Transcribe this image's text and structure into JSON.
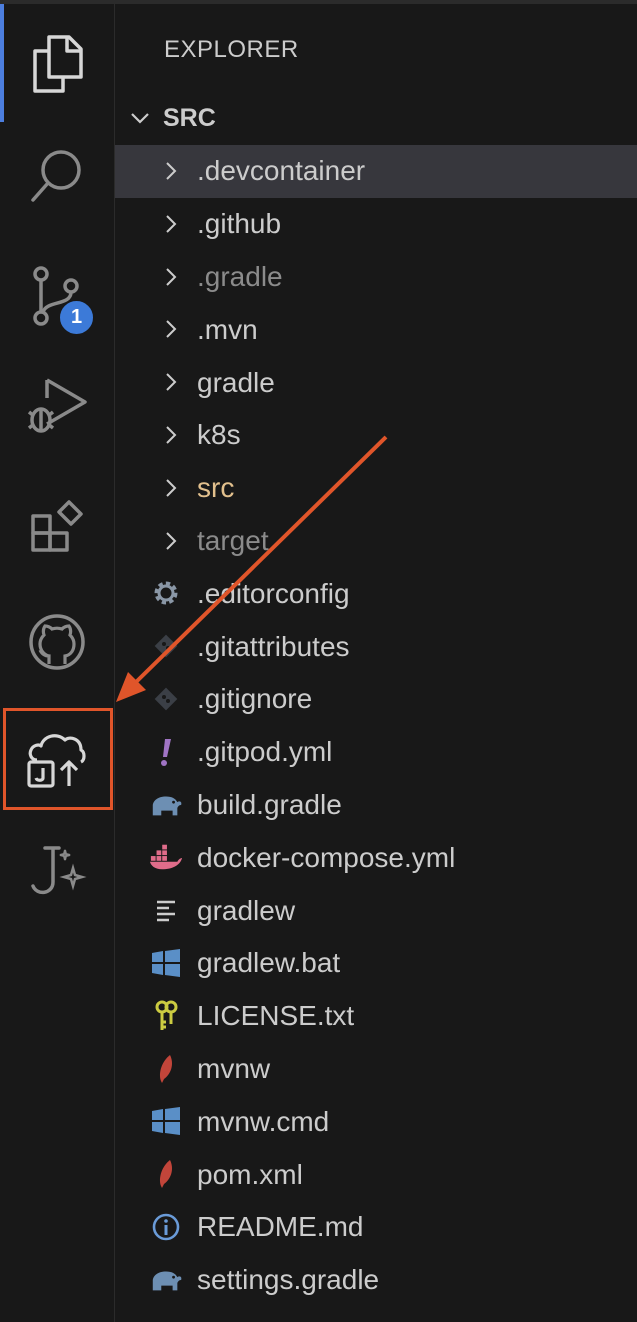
{
  "explorer": {
    "title": "EXPLORER",
    "root_label": "SRC"
  },
  "activity_bar": {
    "items": [
      {
        "name": "explorer",
        "icon": "files-icon"
      },
      {
        "name": "search",
        "icon": "search-icon"
      },
      {
        "name": "source-control",
        "icon": "source-control-icon",
        "badge": "1"
      },
      {
        "name": "run-and-debug",
        "icon": "run-debug-icon"
      },
      {
        "name": "extensions",
        "icon": "extensions-icon"
      },
      {
        "name": "github",
        "icon": "github-icon"
      },
      {
        "name": "java-cloud-deploy",
        "icon": "java-cloud-upload-icon",
        "highlighted": true
      },
      {
        "name": "java-ai",
        "icon": "java-sparkle-icon"
      }
    ]
  },
  "tree": {
    "folders": [
      {
        "label": ".devcontainer",
        "state": "selected"
      },
      {
        "label": ".github",
        "state": "normal"
      },
      {
        "label": ".gradle",
        "state": "ignored"
      },
      {
        "label": ".mvn",
        "state": "normal"
      },
      {
        "label": "gradle",
        "state": "normal"
      },
      {
        "label": "k8s",
        "state": "normal"
      },
      {
        "label": "src",
        "state": "modified"
      },
      {
        "label": "target",
        "state": "ignored"
      }
    ],
    "files": [
      {
        "label": ".editorconfig",
        "icon": "gear-icon"
      },
      {
        "label": ".gitattributes",
        "icon": "git-icon"
      },
      {
        "label": ".gitignore",
        "icon": "git-icon"
      },
      {
        "label": ".gitpod.yml",
        "icon": "gitpod-icon"
      },
      {
        "label": "build.gradle",
        "icon": "gradle-elephant-icon"
      },
      {
        "label": "docker-compose.yml",
        "icon": "docker-icon"
      },
      {
        "label": "gradlew",
        "icon": "text-lines-icon"
      },
      {
        "label": "gradlew.bat",
        "icon": "windows-icon"
      },
      {
        "label": "LICENSE.txt",
        "icon": "key-icon"
      },
      {
        "label": "mvnw",
        "icon": "maven-feather-icon"
      },
      {
        "label": "mvnw.cmd",
        "icon": "windows-icon"
      },
      {
        "label": "pom.xml",
        "icon": "maven-feather-icon"
      },
      {
        "label": "README.md",
        "icon": "info-icon"
      },
      {
        "label": "settings.gradle",
        "icon": "gradle-elephant-icon"
      }
    ]
  },
  "colors": {
    "background": "#181818",
    "selection": "#37373d",
    "badge": "#3c7ad8",
    "annotation": "#e0552a",
    "modified": "#e2c08d"
  }
}
